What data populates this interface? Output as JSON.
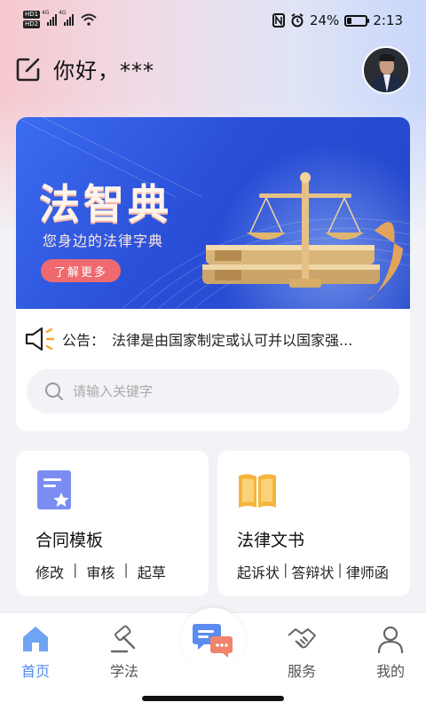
{
  "status_bar": {
    "hd_top": "HD1",
    "hd_bottom": "HD2",
    "signal1_label": "4G",
    "signal2_label": "4G",
    "battery_text": "24%",
    "battery_level": 0.24,
    "time": "2:13"
  },
  "header": {
    "greeting": "你好，***"
  },
  "banner": {
    "title": "法智典",
    "subtitle": "您身边的法律字典",
    "button_label": "了解更多"
  },
  "notice": {
    "label": "公告：",
    "text": "法律是由国家制定或认可并以国家强..."
  },
  "search": {
    "placeholder": "请输入关键字"
  },
  "features": [
    {
      "title": "合同模板",
      "tags": [
        "修改",
        "审核",
        "起草"
      ],
      "icon": "contract-template-icon",
      "color": "#7b8df2"
    },
    {
      "title": "法律文书",
      "tags": [
        "起诉状",
        "答辩状",
        "律师函"
      ],
      "icon": "open-book-icon",
      "color": "#f5b43c"
    }
  ],
  "nav": {
    "items": [
      {
        "label": "首页",
        "icon": "home-icon",
        "active": true
      },
      {
        "label": "学法",
        "icon": "gavel-icon",
        "active": false
      },
      {
        "label": "",
        "icon": "chat-bubbles-icon",
        "active": false
      },
      {
        "label": "服务",
        "icon": "handshake-icon",
        "active": false
      },
      {
        "label": "我的",
        "icon": "user-icon",
        "active": false
      }
    ],
    "separator": "|"
  },
  "colors": {
    "accent": "#4f8bf0",
    "banner_blue": "#2a4fd8",
    "banner_button": "#ee6a6f",
    "chat_accent": "#f0846a"
  }
}
